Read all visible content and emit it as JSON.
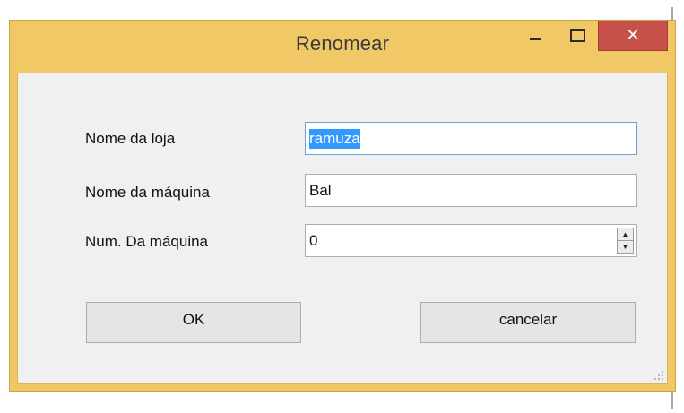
{
  "window": {
    "title": "Renomear",
    "caption_buttons": {
      "minimize_icon": "minimize-icon",
      "maximize_icon": "maximize-icon",
      "close_glyph": "✕"
    }
  },
  "form": {
    "store_name": {
      "label": "Nome da loja",
      "value": "ramuza"
    },
    "machine_name": {
      "label": "Nome da máquina",
      "value": "Bal"
    },
    "machine_number": {
      "label": "Num. Da máquina",
      "value": "0"
    }
  },
  "buttons": {
    "ok_label": "OK",
    "cancel_label": "cancelar"
  },
  "colors": {
    "title_bar": "#f0c866",
    "close_button": "#c7504a",
    "client_area": "#f0f0f0",
    "selection": "#3399ff"
  }
}
